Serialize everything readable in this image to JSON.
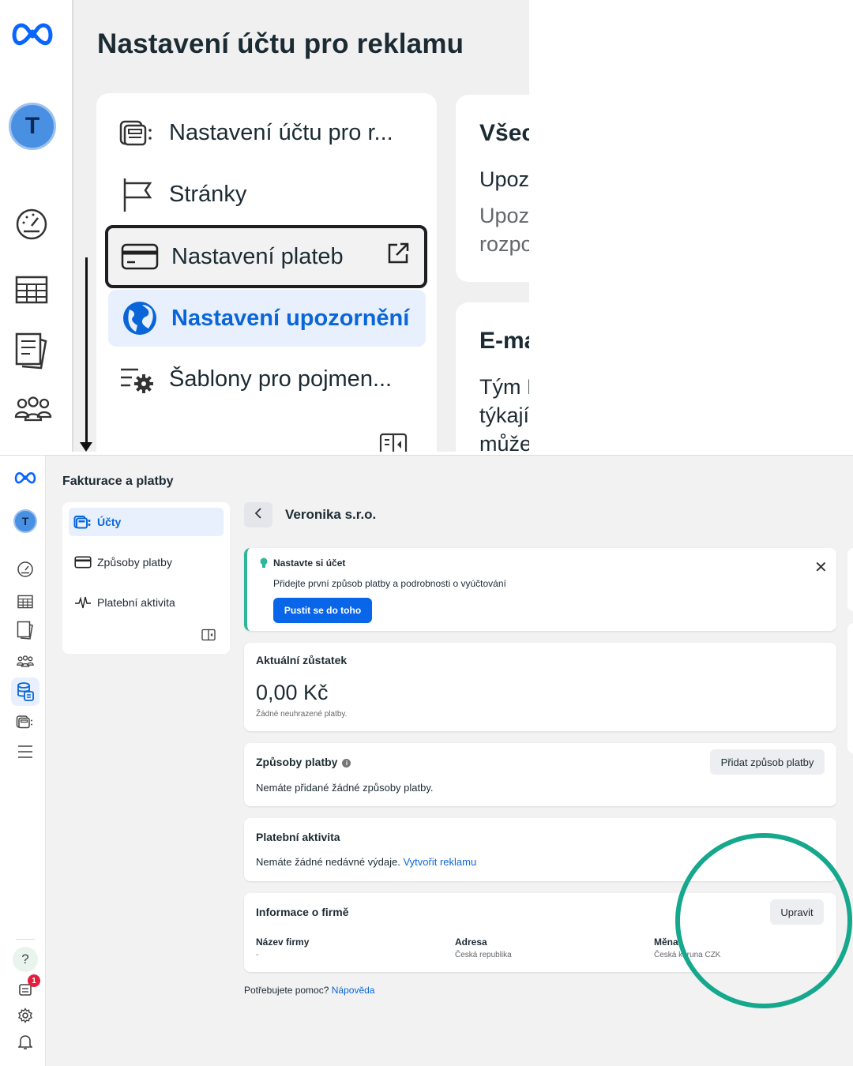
{
  "top_panel": {
    "page_title": "Nastavení účtu pro reklamu",
    "avatar_initial": "T",
    "menu": [
      {
        "label": "Nastavení účtu pro r...",
        "icon": "ad-accounts-icon"
      },
      {
        "label": "Stránky",
        "icon": "flag-icon"
      },
      {
        "label": "Nastavení plateb",
        "icon": "credit-card-icon",
        "highlighted": true
      },
      {
        "label": "Nastavení upozornění",
        "icon": "globe-icon",
        "active": true
      },
      {
        "label": "Šablony pro pojmen...",
        "icon": "settings-list-icon"
      }
    ],
    "right_cards": [
      {
        "title": "Všec",
        "lines": [
          "Upoz",
          "Upoz",
          "rozpo"
        ]
      },
      {
        "title": "E-ma",
        "lines": [
          "Tým F",
          "týkají",
          "může"
        ]
      }
    ]
  },
  "bottom_panel": {
    "section_title": "Fakturace a platby",
    "avatar_initial": "T",
    "notification_count": "1",
    "help_glyph": "?",
    "sidebar": [
      {
        "label": "Účty",
        "icon": "accounts-icon",
        "active": true
      },
      {
        "label": "Způsoby platby",
        "icon": "credit-card-icon"
      },
      {
        "label": "Platební aktivita",
        "icon": "pulse-icon"
      }
    ],
    "company_name": "Veronika s.r.o.",
    "notice": {
      "title": "Nastavte si účet",
      "text": "Přidejte první způsob platby a podrobnosti o vyúčtování",
      "cta": "Pustit se do toho",
      "close": "✕"
    },
    "balance": {
      "title": "Aktuální zůstatek",
      "amount": "0,00 Kč",
      "note": "Žádné neuhrazené platby."
    },
    "payment_methods": {
      "title": "Způsoby platby",
      "add_button": "Přidat způsob platby",
      "empty_text": "Nemáte přidané žádné způsoby platby."
    },
    "payment_activity": {
      "title": "Platební aktivita",
      "text": "Nemáte žádné nedávné výdaje.",
      "link": "Vytvořit reklamu"
    },
    "business_info": {
      "title": "Informace o firmě",
      "edit_button": "Upravit",
      "fields": [
        {
          "label": "Název firmy",
          "value": "-"
        },
        {
          "label": "Adresa",
          "value": "Česká republika"
        },
        {
          "label": "Měna",
          "value": "Česká koruna CZK"
        }
      ]
    },
    "help": {
      "text": "Potřebujete pomoc?",
      "link": "Nápověda"
    }
  },
  "colors": {
    "meta_blue": "#0866ff",
    "accent_blue": "#0a66d8",
    "highlight_circle": "#15a88c",
    "notice_border": "#2fb59b"
  }
}
